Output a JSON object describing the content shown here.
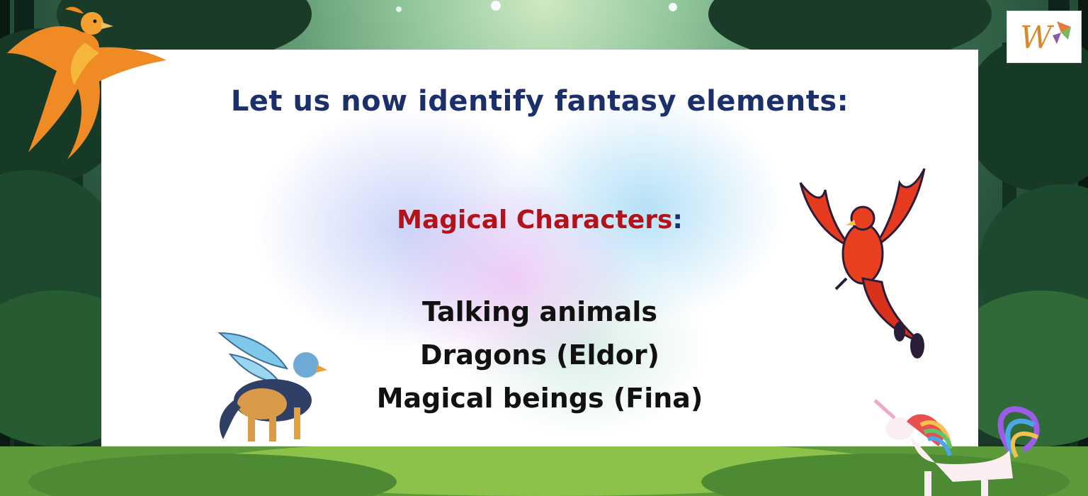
{
  "slide": {
    "title": "Let us now identify fantasy elements:",
    "subheading": "Magical Characters",
    "subheading_suffix": ":",
    "items": [
      "Talking animals",
      "Dragons (Eldor)",
      "Magical beings (Fina)"
    ]
  },
  "logo": {
    "letter": "W"
  },
  "colors": {
    "title": "#1b2f6b",
    "subheading": "#b3121a",
    "items": "#111111"
  },
  "decorations": [
    "phoenix-orange",
    "phoenix-red",
    "griffin",
    "unicorn",
    "forest-background"
  ]
}
